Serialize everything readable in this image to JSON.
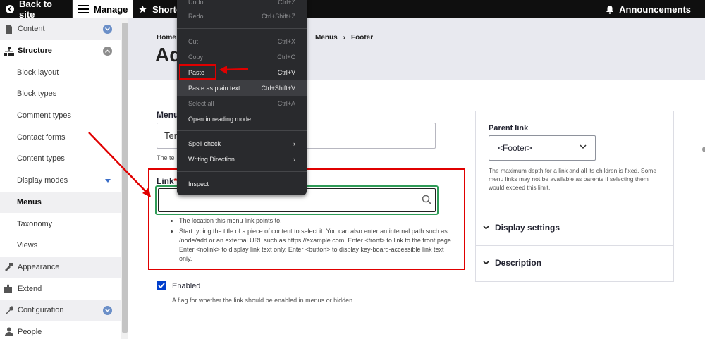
{
  "toolbar": {
    "back_label": "Back to site",
    "manage_label": "Manage",
    "shortcuts_label": "Shortc",
    "announcements_label": "Announcements"
  },
  "sidebar": {
    "items": [
      {
        "label": "Content"
      },
      {
        "label": "Structure"
      },
      {
        "label": "Block layout"
      },
      {
        "label": "Block types"
      },
      {
        "label": "Comment types"
      },
      {
        "label": "Contact forms"
      },
      {
        "label": "Content types"
      },
      {
        "label": "Display modes"
      },
      {
        "label": "Menus"
      },
      {
        "label": "Taxonomy"
      },
      {
        "label": "Views"
      },
      {
        "label": "Appearance"
      },
      {
        "label": "Extend"
      },
      {
        "label": "Configuration"
      },
      {
        "label": "People"
      }
    ]
  },
  "header": {
    "crumb_home": "Home",
    "crumb_menus": "Menus",
    "crumb_footer": "Footer",
    "title": "Ad"
  },
  "form": {
    "menu_title_label": "Menu",
    "menu_title_value": "Ter",
    "menu_title_desc": "The te",
    "link_label": "Link",
    "link_required": "*",
    "help_1": "The location this menu link points to.",
    "help_2": "Start typing the title of a piece of content to select it. You can also enter an internal path such as /node/add or an external URL such as https://example.com. Enter <front> to link to the front page. Enter <nolink> to display link text only. Enter <button> to display key-board-accessible link text only.",
    "enabled_label": "Enabled",
    "enabled_desc": "A flag for whether the link should be enabled in menus or hidden."
  },
  "panel": {
    "parent_label": "Parent link",
    "parent_value": "<Footer>",
    "parent_desc": "The maximum depth for a link and all its children is fixed. Some menu links may not be available as parents if selecting them would exceed this limit.",
    "display_settings": "Display settings",
    "description": "Description"
  },
  "context_menu": {
    "items": [
      {
        "label": "Undo",
        "shortcut": "Ctrl+Z"
      },
      {
        "label": "Redo",
        "shortcut": "Ctrl+Shift+Z"
      },
      {
        "label": "Cut",
        "shortcut": "Ctrl+X"
      },
      {
        "label": "Copy",
        "shortcut": "Ctrl+C"
      },
      {
        "label": "Paste",
        "shortcut": "Ctrl+V"
      },
      {
        "label": "Paste as plain text",
        "shortcut": "Ctrl+Shift+V"
      },
      {
        "label": "Select all",
        "shortcut": "Ctrl+A"
      },
      {
        "label": "Open in reading mode",
        "shortcut": ""
      },
      {
        "label": "Spell check",
        "shortcut": "›"
      },
      {
        "label": "Writing Direction",
        "shortcut": "›"
      },
      {
        "label": "Inspect",
        "shortcut": ""
      }
    ]
  },
  "colors": {
    "toolbar_bg": "#0f0f0f",
    "annotation_red": "#e00000",
    "focus_green": "#2f9b57",
    "checkbox_blue": "#003ecc"
  }
}
